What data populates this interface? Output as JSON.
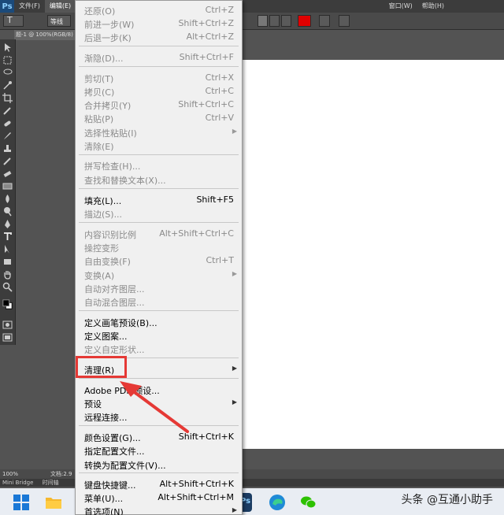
{
  "menubar": {
    "logo": "Ps",
    "items": [
      "文件(F)",
      "编辑(E)"
    ],
    "right_items": [
      "窗口(W)",
      "帮助(H)"
    ]
  },
  "options_bar": {
    "font_name": "等线"
  },
  "document": {
    "tab": "题-1 @ 100%(RGB/8)"
  },
  "status_bar": {
    "zoom": "100%",
    "doc_info": "文档:2.9"
  },
  "bottom_tabs": [
    "Mini Bridge",
    "时间轴"
  ],
  "edit_menu": {
    "items": [
      {
        "label": "还原(O)",
        "shortcut": "Ctrl+Z",
        "disabled": true
      },
      {
        "label": "前进一步(W)",
        "shortcut": "Shift+Ctrl+Z",
        "disabled": true
      },
      {
        "label": "后退一步(K)",
        "shortcut": "Alt+Ctrl+Z",
        "disabled": true
      },
      {
        "label": "渐隐(D)...",
        "shortcut": "Shift+Ctrl+F",
        "disabled": true
      },
      {
        "label": "剪切(T)",
        "shortcut": "Ctrl+X",
        "disabled": true
      },
      {
        "label": "拷贝(C)",
        "shortcut": "Ctrl+C",
        "disabled": true
      },
      {
        "label": "合并拷贝(Y)",
        "shortcut": "Shift+Ctrl+C",
        "disabled": true
      },
      {
        "label": "粘贴(P)",
        "shortcut": "Ctrl+V",
        "disabled": true
      },
      {
        "label": "选择性粘贴(I)",
        "shortcut": "",
        "disabled": true,
        "submenu": true
      },
      {
        "label": "清除(E)",
        "shortcut": "",
        "disabled": true
      },
      {
        "label": "拼写检查(H)...",
        "shortcut": "",
        "disabled": true
      },
      {
        "label": "查找和替换文本(X)...",
        "shortcut": "",
        "disabled": true
      },
      {
        "label": "填充(L)...",
        "shortcut": "Shift+F5",
        "disabled": false
      },
      {
        "label": "描边(S)...",
        "shortcut": "",
        "disabled": true
      },
      {
        "label": "内容识别比例",
        "shortcut": "Alt+Shift+Ctrl+C",
        "disabled": true
      },
      {
        "label": "操控变形",
        "shortcut": "",
        "disabled": true
      },
      {
        "label": "自由变换(F)",
        "shortcut": "Ctrl+T",
        "disabled": true
      },
      {
        "label": "变换(A)",
        "shortcut": "",
        "disabled": true,
        "submenu": true
      },
      {
        "label": "自动对齐图层...",
        "shortcut": "",
        "disabled": true
      },
      {
        "label": "自动混合图层...",
        "shortcut": "",
        "disabled": true
      },
      {
        "label": "定义画笔预设(B)...",
        "shortcut": "",
        "disabled": false
      },
      {
        "label": "定义图案...",
        "shortcut": "",
        "disabled": false
      },
      {
        "label": "定义自定形状...",
        "shortcut": "",
        "disabled": true
      },
      {
        "label": "清理(R)",
        "shortcut": "",
        "disabled": false,
        "submenu": true
      },
      {
        "label": "Adobe PDF 预设...",
        "shortcut": "",
        "disabled": false
      },
      {
        "label": "预设",
        "shortcut": "",
        "disabled": false,
        "submenu": true
      },
      {
        "label": "远程连接...",
        "shortcut": "",
        "disabled": false
      },
      {
        "label": "颜色设置(G)...",
        "shortcut": "Shift+Ctrl+K",
        "disabled": false
      },
      {
        "label": "指定配置文件...",
        "shortcut": "",
        "disabled": false
      },
      {
        "label": "转换为配置文件(V)...",
        "shortcut": "",
        "disabled": false
      },
      {
        "label": "键盘快捷键...",
        "shortcut": "Alt+Shift+Ctrl+K",
        "disabled": false
      },
      {
        "label": "菜单(U)...",
        "shortcut": "Alt+Shift+Ctrl+M",
        "disabled": false
      },
      {
        "label": "首选项(N)",
        "shortcut": "",
        "disabled": false,
        "submenu": true
      }
    ]
  },
  "watermark": "头条 @互通小助手",
  "colors": {
    "highlight": "#e53935",
    "menu_bg": "#f0f0f0",
    "disabled_text": "#8a8a8a"
  }
}
